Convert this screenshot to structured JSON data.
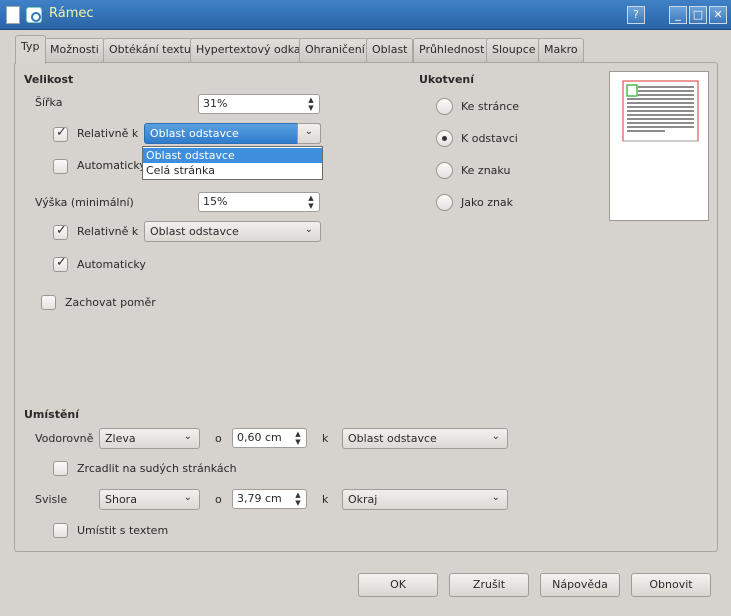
{
  "window": {
    "title": "Rámec",
    "help_btn": "?",
    "min_btn": "_",
    "max_btn": "□",
    "close_btn": "✕"
  },
  "tabs": [
    "Typ",
    "Možnosti",
    "Obtékání textu",
    "Hypertextový odkaz",
    "Ohraničení",
    "Oblast",
    "Průhlednost",
    "Sloupce",
    "Makro"
  ],
  "size": {
    "heading": "Velikost",
    "width_label": "Šířka",
    "width_value": "31%",
    "rel_width_label": "Relativně k",
    "rel_width_value": "Oblast odstavce",
    "auto_width_label": "Automaticky",
    "height_label": "Výška (minimální)",
    "height_value": "15%",
    "rel_height_label": "Relativně k",
    "rel_height_value": "Oblast odstavce",
    "auto_height_label": "Automaticky",
    "keep_ratio_label": "Zachovat poměr"
  },
  "dropdown_options": [
    "Oblast odstavce",
    "Celá stránka"
  ],
  "anchor": {
    "heading": "Ukotvení",
    "options": [
      "Ke stránce",
      "K odstavci",
      "Ke znaku",
      "Jako znak"
    ],
    "selected_index": 1
  },
  "position": {
    "heading": "Umístění",
    "horiz_label": "Vodorovně",
    "horiz_value": "Zleva",
    "by_label": "o",
    "horiz_by": "0,60 cm",
    "to_label": "k",
    "horiz_to": "Oblast odstavce",
    "mirror_label": "Zrcadlit na sudých stránkách",
    "vert_label": "Svisle",
    "vert_value": "Shora",
    "vert_by": "3,79 cm",
    "vert_to": "Okraj",
    "follow_text_label": "Umístit s textem"
  },
  "buttons": {
    "ok": "OK",
    "cancel": "Zrušit",
    "help": "Nápověda",
    "reset": "Obnovit"
  }
}
